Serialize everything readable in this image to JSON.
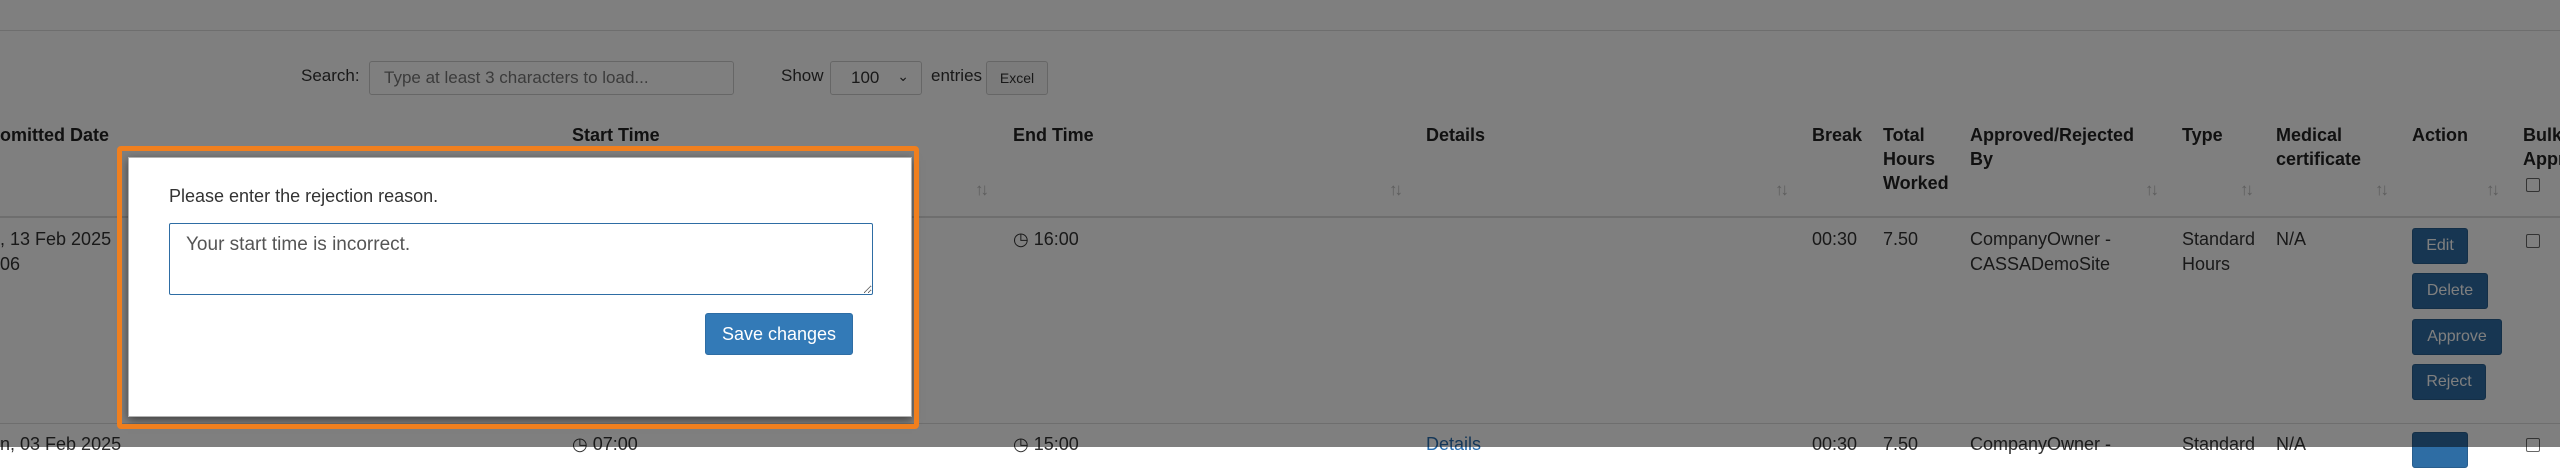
{
  "toolbar": {
    "search_label": "Search:",
    "search_placeholder": "Type at least 3 characters to load...",
    "show_label": "Show",
    "show_value": "100",
    "entries_label": "entries",
    "excel_label": "Excel"
  },
  "table": {
    "headers": {
      "submitted_date": "omitted Date",
      "start_time": "Start Time",
      "end_time": "End Time",
      "details": "Details",
      "break": "Break",
      "total_hours_1": "Total",
      "total_hours_2": "Hours",
      "total_hours_3": "Worked",
      "approved_by_1": "Approved/Rejected",
      "approved_by_2": "By",
      "type": "Type",
      "medical_1": "Medical",
      "medical_2": "certificate",
      "action": "Action",
      "bulk_1": "Bulk",
      "bulk_2": "Appr"
    },
    "rows": [
      {
        "submitted_1": ", 13 Feb 2025",
        "submitted_2": "06",
        "end_time": "16:00",
        "break": "00:30",
        "total": "7.50",
        "approved_by_1": "CompanyOwner -",
        "approved_by_2": "CASSADemoSite",
        "type_1": "Standard",
        "type_2": "Hours",
        "medical": "N/A",
        "actions": {
          "edit": "Edit",
          "delete": "Delete",
          "approve": "Approve",
          "reject": "Reject"
        }
      },
      {
        "submitted_1": "n, 03 Feb 2025",
        "start_time": "07:00",
        "end_time": "15:00",
        "details": "Details",
        "break": "00:30",
        "total": "7.50",
        "approved_by_1": "CompanyOwner -",
        "type_1": "Standard",
        "medical": "N/A"
      }
    ]
  },
  "icons": {
    "clock": "clock-icon",
    "sort": "sort-icon",
    "chevron": "chevron-down-icon"
  },
  "modal": {
    "prompt": "Please enter the rejection reason.",
    "reason_value": "Your start time is incorrect.",
    "save_label": "Save changes"
  },
  "colors": {
    "highlight": "#f07f1e",
    "primary": "#337ab7",
    "link": "#2a6fb0"
  }
}
